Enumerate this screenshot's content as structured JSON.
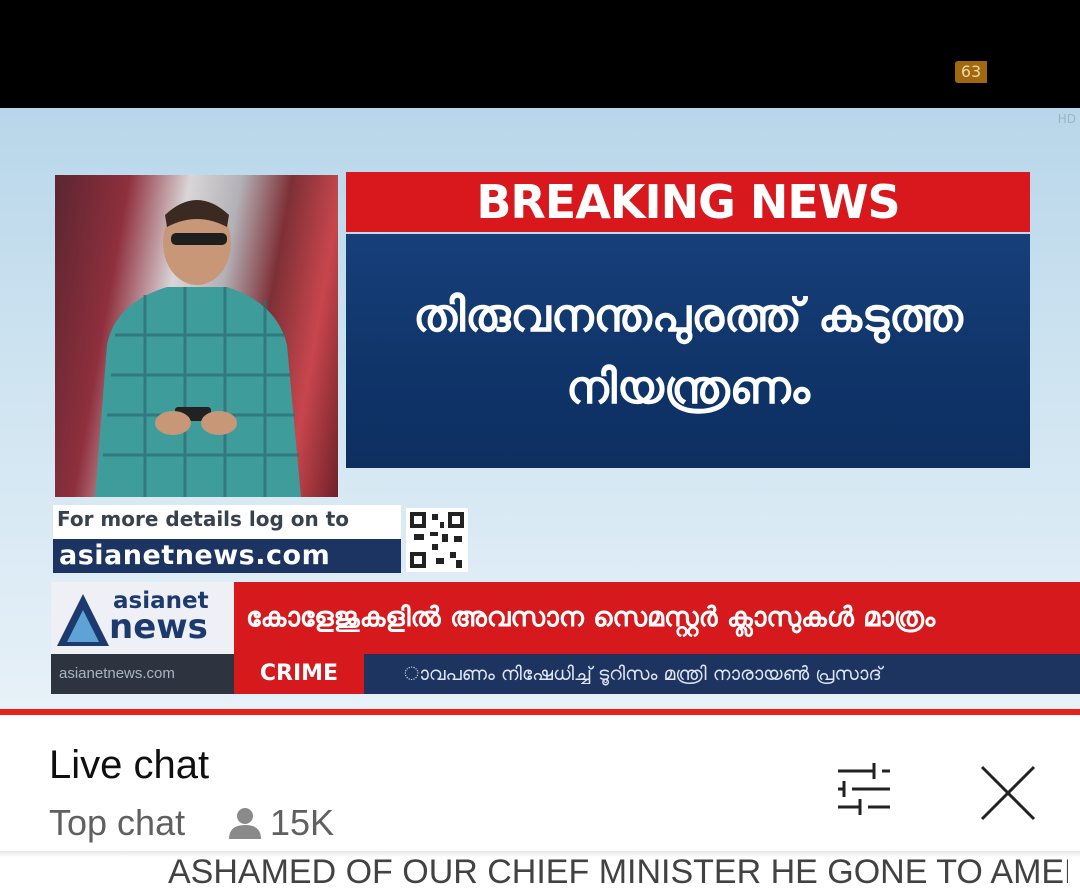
{
  "status_badge": "63",
  "video": {
    "breaking_label": "BREAKING NEWS",
    "headline_line1": "തിരുവനന്തപുരത്ത് കടുത്ത",
    "headline_line2": "നിയന്ത്രണം",
    "details_text": "For more details log on to",
    "details_url": "asianetnews.com",
    "brand_top": "asianet",
    "brand_bottom_word": "news",
    "brand_site": "asianetnews.com",
    "ticker_main": "കോളേജുകളിൽ അവസാന സെമസ്റ്റർ ക്ലാസുകൾ മാത്രം",
    "ticker_category": "CRIME",
    "ticker_secondary": "ാവപണം നിഷേധിച്ച് ടൂറിസം മന്ത്രി നാരായൺ പ്രസാദ്",
    "progress_fraction": 1.0,
    "colors": {
      "breaking_red": "#d8181c",
      "headline_navy": "#0f3469",
      "progress_red": "#e62117"
    }
  },
  "chat": {
    "title": "Live chat",
    "mode_label": "Top chat",
    "viewer_count": "15K",
    "icons": {
      "viewers": "person-icon",
      "filter": "sliders-icon",
      "close": "close-icon"
    },
    "partial_message": "ASHAMED OF OUR CHIEF MINISTER HE GONE TO AMERICA"
  }
}
